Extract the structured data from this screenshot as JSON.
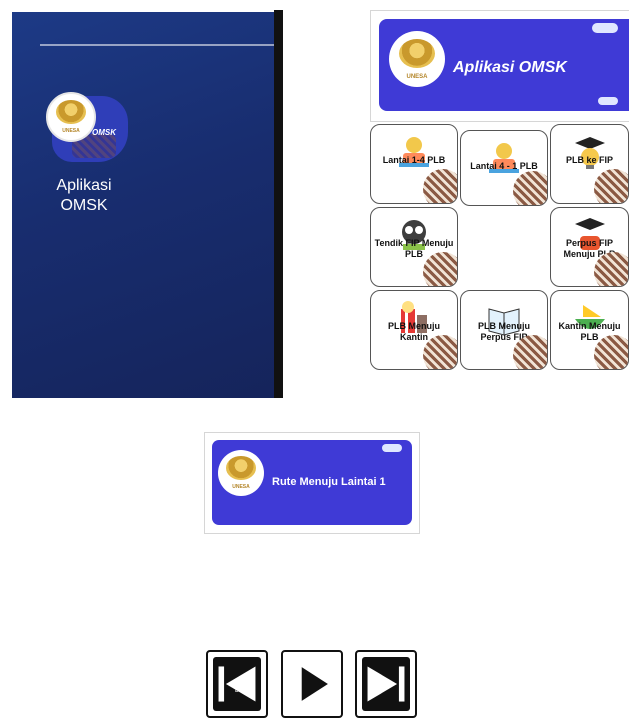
{
  "phone": {
    "app_label": "Aplikasi\nOMSK",
    "app_brand": "OMSK",
    "emblem_text": "UNESA"
  },
  "header": {
    "title": "Aplikasi OMSK",
    "emblem_text": "UNESA"
  },
  "menu": {
    "items": [
      {
        "label": "Lantai 1-4 PLB",
        "icon": "reading-student-icon"
      },
      {
        "label": "Lantai 4 - 1 PLB",
        "icon": "reading-student-icon"
      },
      {
        "label": "PLB ke FIP",
        "icon": "graduation-bulb-icon"
      },
      {
        "label": "Tendik FIP Menuju PLB",
        "icon": "owl-book-icon"
      },
      {
        "label": "Perpus FIP Menuju PLB",
        "icon": "graduation-pot-icon"
      },
      {
        "label": "PLB Menuju Kantin",
        "icon": "popcorn-drink-icon"
      },
      {
        "label": "PLB Menuju Perpus FIP",
        "icon": "open-book-icon"
      },
      {
        "label": "Kantin Menuju PLB",
        "icon": "food-bowl-icon"
      }
    ]
  },
  "route_header": {
    "title": "Rute Menuju Laintai 1",
    "emblem_text": "UNESA"
  },
  "controls": {
    "back_label": "bali",
    "prev_icon": "skip-back-icon",
    "play_icon": "play-icon",
    "next_icon": "skip-forward-icon"
  },
  "colors": {
    "banner": "#3f3ad6",
    "phone_bg": "#182d6f",
    "gold": "#c9992c"
  }
}
